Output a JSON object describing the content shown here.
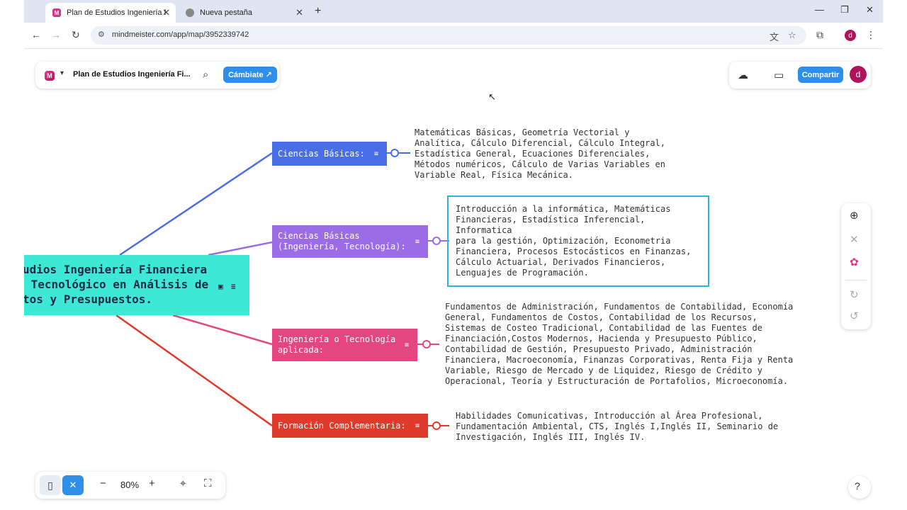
{
  "browser": {
    "tabs": [
      {
        "title": "Plan de Estudios Ingeniería Fina",
        "favicon": "mindmeister-icon"
      },
      {
        "title": "Nueva pestaña",
        "favicon": "chrome-icon"
      }
    ],
    "url": "mindmeister.com/app/map/3952339742",
    "profile_initial": "d"
  },
  "app": {
    "map_title": "Plan de Estudios Ingeniería Fi...",
    "upgrade_label": "Cámbiate ↗",
    "share_label": "Compartir",
    "user_initial": "d",
    "zoom": "80%"
  },
  "map": {
    "root": {
      "lines": [
        "udios Ingeniería Financiera",
        " Tecnológico en Análisis de",
        "tos y Presupuestos."
      ]
    },
    "branches": [
      {
        "label": "Ciencias Básicas:",
        "color": "#4a6ee8",
        "text": "Matemáticas Básicas, Geometría Vectorial y\nAnalítica, Cálculo Diferencial, Cálculo Integral,\nEstadística General, Ecuaciones Diferenciales,\nMétodos numéricos, Cálculo de Varias Variables en\nVariable Real, Física Mecánica."
      },
      {
        "label": "Ciencias Básicas\n(Ingeniería, Tecnología):",
        "color": "#9c6ce6",
        "text": "Introducción a la informática, Matemáticas\nFinancieras, Estadística Inferencial,\nInformatica\npara la gestión, Optimización, Econometria\nFinanciera, Procesos Estocásticos en Finanzas,\nCálculo Actuarial, Derivados Financieros,\nLenguajes de Programación."
      },
      {
        "label": "Ingeniería o Tecnología\naplicada:",
        "color": "#e4477f",
        "text": "Fundamentos de Administración, Fundamentos de Contabilidad, Economía\nGeneral, Fundamentos de Costos, Contabilidad de los Recursos,\nSistemas de Costeo Tradicional, Contabilidad de las Fuentes de\nFinanciación,Costos Modernos, Hacienda y Presupuesto Público,\nContabilidad de Gestión, Presupuesto Privado, Administración\nFinanciera, Macroeconomía, Finanzas Corporativas, Renta Fija y Renta\nVariable, Riesgo de Mercado y de Liquidez, Riesgo de Crédito y\nOperacional, Teoría y Estructuración de Portafolios, Microeconomía."
      },
      {
        "label": "Formación Complementaria:",
        "color": "#e03a2c",
        "text": "Habilidades Comunicativas, Introducción al Área Profesional,\nFundamentación Ambiental, CTS, Inglés I,Inglés II, Seminario de\nInvestigación, Inglés III, Inglés IV."
      }
    ]
  },
  "colors": {
    "root_fill": "#3de8d6",
    "brand_blue": "#2f8fe8",
    "selection": "#2bb6dc"
  }
}
